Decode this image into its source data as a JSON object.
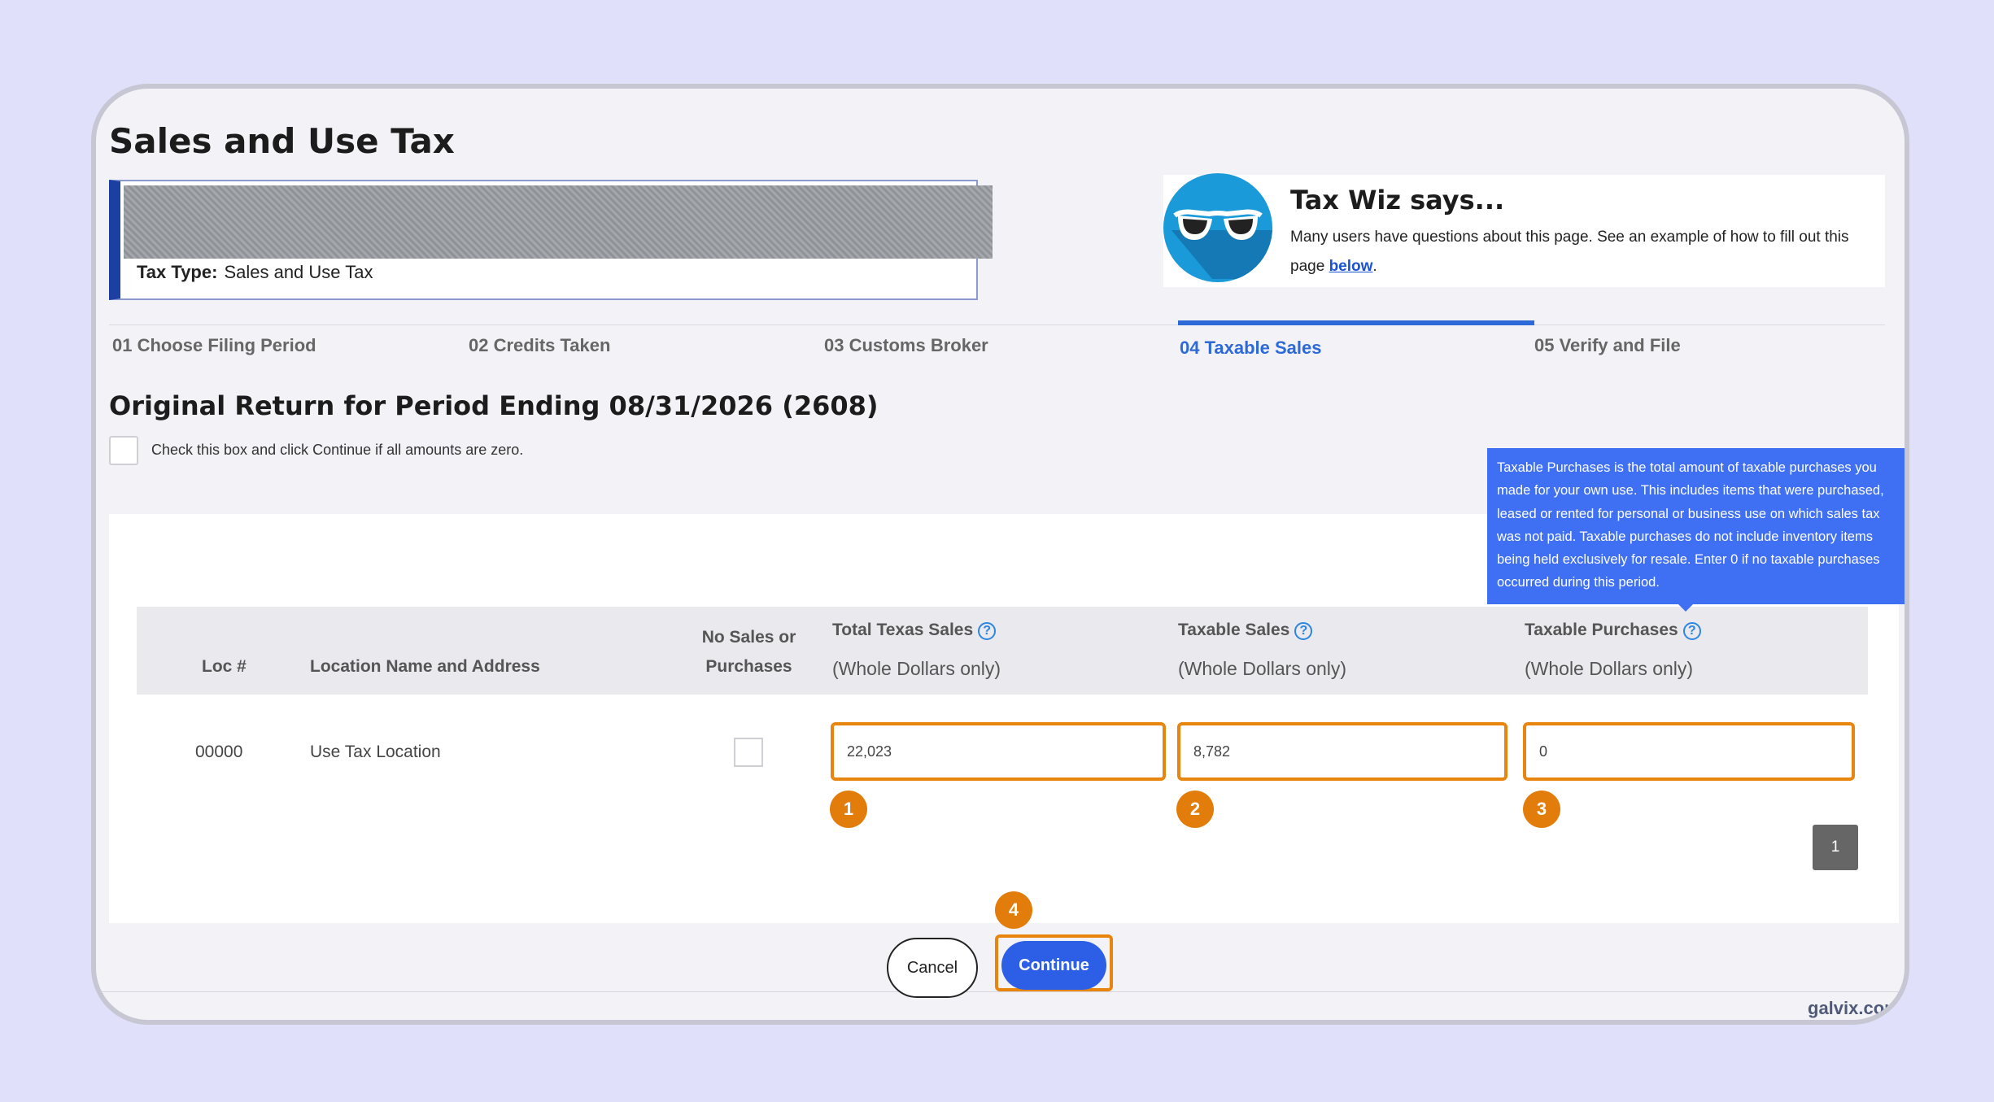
{
  "page": {
    "title": "Sales and Use Tax",
    "tax_type_label": "Tax Type:",
    "tax_type_value": "Sales and Use Tax"
  },
  "tax_wiz": {
    "title": "Tax Wiz says...",
    "text": "Many users have questions about this page. See an example of how to fill out this page",
    "link": "below"
  },
  "steps": [
    {
      "label": "01 Choose Filing Period"
    },
    {
      "label": "02 Credits Taken"
    },
    {
      "label": "03 Customs Broker"
    },
    {
      "label": "04 Taxable Sales",
      "active": true
    },
    {
      "label": "05 Verify and File"
    }
  ],
  "return": {
    "title": "Original Return for Period Ending 08/31/2026 (2608)",
    "zero_checkbox_label": "Check this box and click Continue if all amounts are zero."
  },
  "tooltip": {
    "text": "Taxable Purchases is the total amount of taxable purchases you made for your own use. This includes items that were purchased, leased or rented for personal or business use on which sales tax was not paid. Taxable purchases do not include inventory items being held exclusively for resale. Enter 0 if no taxable purchases occurred during this period."
  },
  "table": {
    "columns": {
      "loc": "Loc #",
      "location": "Location Name and Address",
      "no_sales_line1": "No Sales or",
      "no_sales_line2": "Purchases",
      "total_sales": "Total Texas Sales",
      "taxable_sales": "Taxable Sales",
      "taxable_purchases": "Taxable Purchases",
      "whole_dollars": "(Whole Dollars only)",
      "help_glyph": "?"
    },
    "rows": [
      {
        "loc": "00000",
        "location": "Use Tax Location",
        "total_sales": "22,023",
        "taxable_sales": "8,782",
        "taxable_purchases": "0"
      }
    ],
    "page_number": "1"
  },
  "annotations": {
    "badge_1": "1",
    "badge_2": "2",
    "badge_3": "3",
    "badge_4": "4"
  },
  "buttons": {
    "cancel": "Cancel",
    "continue": "Continue"
  },
  "watermark": "galvix.com",
  "colors": {
    "primary_blue": "#2d5fe6",
    "highlight_orange": "#e8850e",
    "badge_orange": "#e27d0b",
    "tooltip_blue": "#3f6ff2",
    "wiz_blue": "#1a9ad8"
  },
  "icons": {
    "help": "question-circle-icon",
    "wiz_avatar": "sunglasses-avatar-icon"
  }
}
